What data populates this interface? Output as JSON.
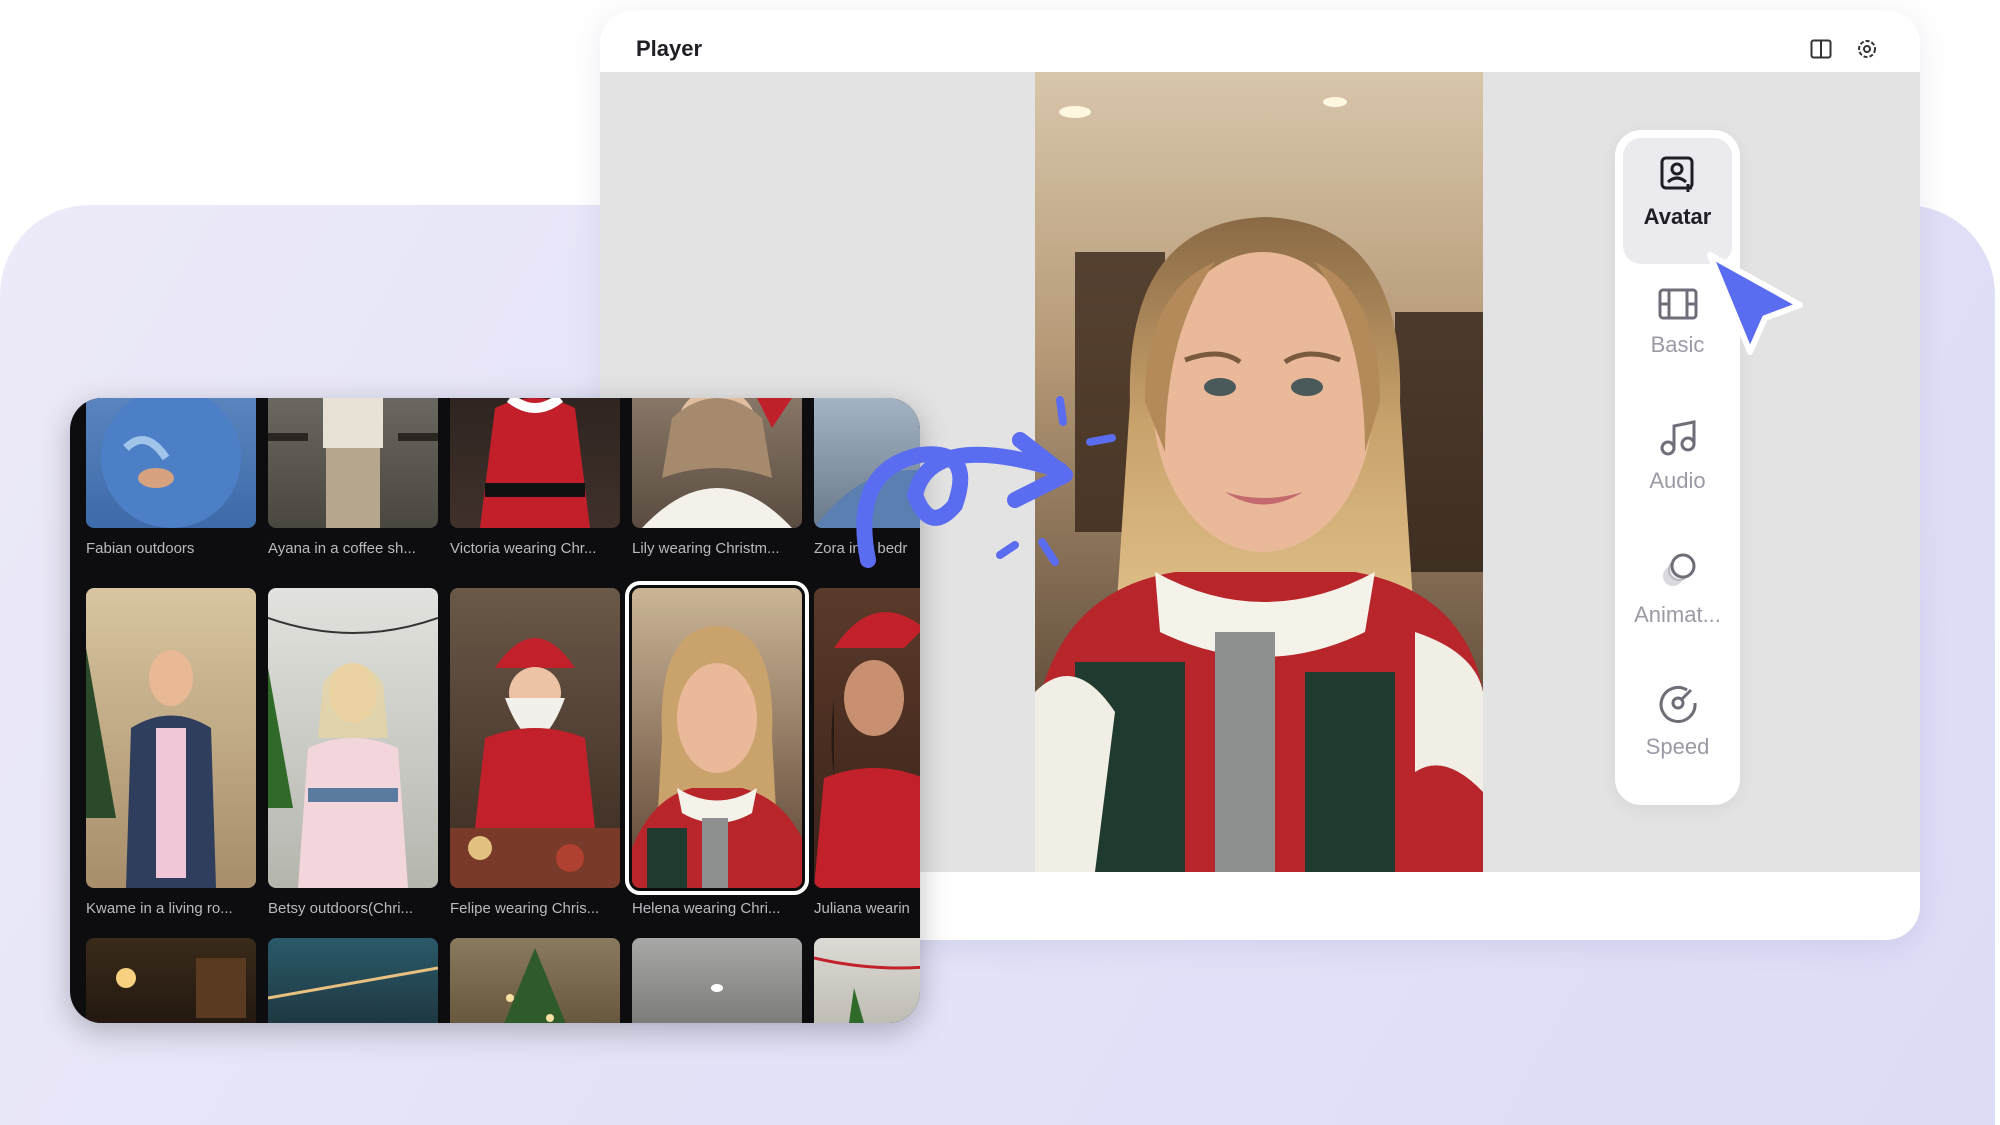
{
  "player": {
    "title": "Player",
    "icons": [
      "panel-layout-icon",
      "settings-gear-icon"
    ]
  },
  "tools": [
    {
      "label": "Avatar",
      "icon": "avatar-icon",
      "active": true
    },
    {
      "label": "Basic",
      "icon": "film-icon",
      "active": false
    },
    {
      "label": "Audio",
      "icon": "music-note-icon",
      "active": false
    },
    {
      "label": "Animat...",
      "icon": "animation-icon",
      "active": false
    },
    {
      "label": "Speed",
      "icon": "speed-gauge-icon",
      "active": false
    }
  ],
  "gallery": {
    "row1": [
      {
        "caption": "Fabian outdoors"
      },
      {
        "caption": "Ayana in a coffee sh..."
      },
      {
        "caption": "Victoria wearing Chr..."
      },
      {
        "caption": "Lily wearing Christm..."
      },
      {
        "caption": "Zora in a bedr"
      }
    ],
    "row2": [
      {
        "caption": "Kwame in a living ro..."
      },
      {
        "caption": "Betsy outdoors(Chri..."
      },
      {
        "caption": "Felipe wearing Chris..."
      },
      {
        "caption": "Helena wearing Chri...",
        "selected": true
      },
      {
        "caption": "Juliana wearin"
      }
    ]
  },
  "colors": {
    "accent": "#5a6cf0",
    "panel_bg": "#e3e3f8"
  }
}
